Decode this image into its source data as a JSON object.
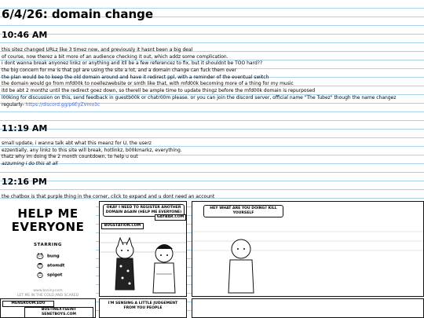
{
  "post": {
    "title": "6/4/26: domain change"
  },
  "updates": [
    {
      "time": "10:46 AM",
      "lines": [
        "this sitez changed URLz like 3 timez now, and previously it hasnt been a big deal",
        "of course, now therez a bit more of an audience checking it out, which addz some complication.",
        "i dont wanna break anyonez linkz or anything and itll be a few referencez to fix, but it shouldnt be TOO hard??",
        "the big concern for me is that ppl are using the site a lot, and a domain change can fuck them over",
        "the plan would be to keep the old domain around and have it redirect ppl, with a reminder of the eventual switch",
        "the domain would go from mfd00k to noellezwebsite or smth like that, with mfd00k becoming more of a thing for my music",
        "itd be abt 2 monthz until the redirect goez down, so therell be ample time to update thingz before the mfd00k domain is repurposed",
        "l00king for discussion on this, send feedback in guestb00k or chatr00m please. or you can join the discord server, official name \"The Tubez\" though the name changez"
      ],
      "last_prefix": "regularly- ",
      "link": "https://discord.gg/p6EyZVmo3c"
    },
    {
      "time": "11:19 AM",
      "lines": [
        "small update, i wanna talk abt what this meanz for U, the userz",
        "ezzentially, any linkz to this site will break, hotlinkz, b00kmarkz, everything.",
        "thatz why im doing the 2 month countdown, to help u out"
      ],
      "italic_line": "azzuming i do this at all"
    },
    {
      "time": "12:16 PM",
      "lines": [
        "the chatbox is that purple thing in the corner, click to expand and u dont need an account"
      ]
    }
  ],
  "comic": {
    "title_line1": "HELP ME",
    "title_line2": "EVERYONE",
    "starring": "STARRING",
    "cast": [
      "bung",
      "atomdt",
      "spigot"
    ],
    "credit1": "www.bnsiny.com",
    "credit2": "LET ME IN THE COLD AND SCARED",
    "panel1_bubble": "OKAY I NEED TO REGISTER ANOTHER DOMAIN AGAIN (HELP ME EVERYONE)",
    "panel1_sign_left": "BUGSTATION.COM",
    "panel1_sign_right": "GAYBAR.COM",
    "panel2_bubble": "HEY WHAT ARE YOU DOING? KILL YOURSELF",
    "panel3_sign1": "MENSROOM.EDU",
    "panel3_sign2": "BUSTINEXTSEINT SENETBOYS.COM",
    "panel4_bubble": "I'M SENSING A LITTLE JUDGEMENT FROM YOU PEOPLE"
  },
  "colors": {
    "rule_line": "#a9d2f0",
    "link": "#4a6fd6"
  }
}
